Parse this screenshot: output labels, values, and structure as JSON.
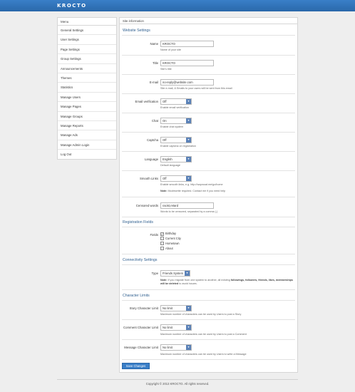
{
  "brand": "KROCTO",
  "sidebar": {
    "header": "Menu",
    "items": [
      {
        "label": "General Settings"
      },
      {
        "label": "User Settings"
      },
      {
        "label": "Page Settings"
      },
      {
        "label": "Group Settings"
      },
      {
        "label": "Announcements"
      },
      {
        "label": "Themes"
      },
      {
        "label": "Statistics"
      },
      {
        "label": "Manage Users"
      },
      {
        "label": "Manage Pages"
      },
      {
        "label": "Manage Groups"
      },
      {
        "label": "Manage Reports"
      },
      {
        "label": "Manage Ads"
      },
      {
        "label": "Manage Admin Login"
      },
      {
        "label": "Log Out"
      }
    ]
  },
  "panel": {
    "header": "Site information",
    "sections": {
      "website": "Website Settings",
      "registration": "Registration Fields",
      "connectivity": "Connectivity Settings",
      "limits": "Character Limits"
    }
  },
  "fields": {
    "name": {
      "label": "Name",
      "value": "KROCTO",
      "help": "Name of your site"
    },
    "title": {
      "label": "Title",
      "value": "KROCTO",
      "help": "Site's title"
    },
    "email": {
      "label": "E-mail",
      "value": "no-reply@website.com",
      "help": "Site e-mail, & Emails to your users will be sent from this email"
    },
    "email_verification": {
      "label": "Email verification",
      "value": "Off",
      "help": "Enable email verification"
    },
    "chat": {
      "label": "Chat",
      "value": "On",
      "help": "Enable chat system"
    },
    "captcha": {
      "label": "Captcha",
      "value": "Off",
      "help": "Enable captcha on registration"
    },
    "language": {
      "label": "Language",
      "value": "English",
      "help": "Default language"
    },
    "smooth_links": {
      "label": "Smooth Links",
      "value": "Off",
      "help": "Enable smooth links, e.g. http://wopwoat.me/go/home",
      "note_label": "Note:",
      "note": "Modrewrite required. Contact me if you need help"
    },
    "censored_words": {
      "label": "Censored words",
      "value": "racist,retard",
      "help": "Words to be censored, separated by a comma (,)"
    },
    "fields": {
      "label": "Fields",
      "options": [
        {
          "label": "Birthday",
          "checked": true
        },
        {
          "label": "Current City",
          "checked": false
        },
        {
          "label": "Hometown",
          "checked": false
        },
        {
          "label": "About",
          "checked": false
        }
      ]
    },
    "type": {
      "label": "Type",
      "value": "Friends System",
      "note_label": "Note:",
      "note_1": "If you migrate from one system to another, all existing ",
      "note_bold": "followings, followers, friends, likes, memberships will be deleted",
      "note_2": " to avoid issues."
    },
    "story_limit": {
      "label": "Story Character Limit",
      "value": "No limit",
      "help": "Maximum number of characters can be used by Users to post a Story"
    },
    "comment_limit": {
      "label": "Comment Character Limit",
      "value": "No limit",
      "help": "Maximum number of characters can be used by Users to post a Comment"
    },
    "message_limit": {
      "label": "Message Character Limit",
      "value": "No limit",
      "help": "Maximum number of characters can be used by Users to write a Message"
    }
  },
  "save_label": "Save Changes",
  "footer": "Copyright © 2013 KROCTO. All rights reserved."
}
